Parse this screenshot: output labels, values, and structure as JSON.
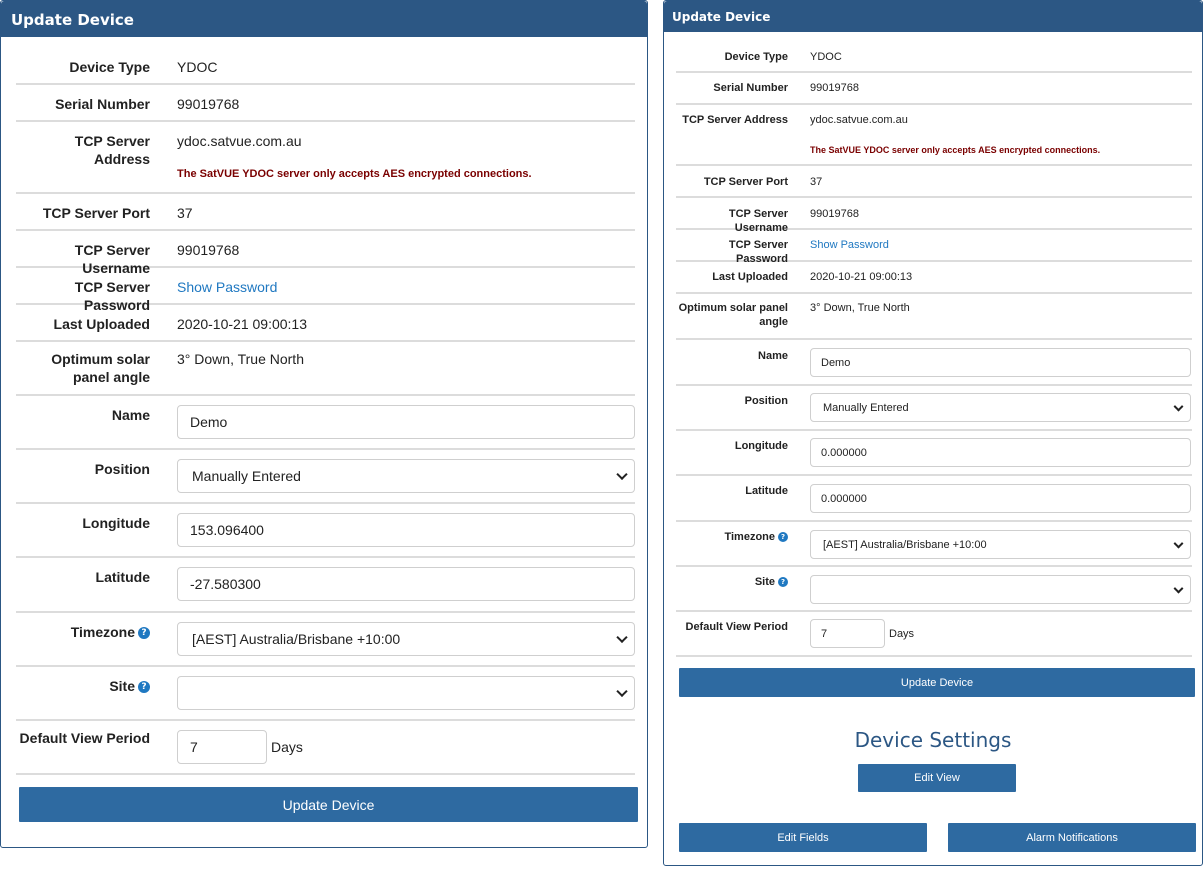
{
  "panel": {
    "title": "Update Device",
    "fields": {
      "device_type": {
        "label": "Device Type",
        "value": "YDOC"
      },
      "serial_number": {
        "label": "Serial Number",
        "value": "99019768"
      },
      "tcp_server_address": {
        "label": "TCP Server Address",
        "value": "ydoc.satvue.com.au",
        "notice": "The SatVUE YDOC server only accepts AES encrypted connections."
      },
      "tcp_server_port": {
        "label": "TCP Server Port",
        "value": "37"
      },
      "tcp_server_username": {
        "label": "TCP Server Username",
        "value": "99019768"
      },
      "tcp_server_password": {
        "label": "TCP Server Password",
        "link": "Show Password"
      },
      "last_uploaded": {
        "label": "Last Uploaded",
        "value": "2020-10-21 09:00:13"
      },
      "solar_angle": {
        "label": "Optimum solar panel angle",
        "value": "3° Down, True North"
      },
      "name": {
        "label": "Name",
        "value": "Demo"
      },
      "position": {
        "label": "Position",
        "value": "Manually Entered"
      },
      "longitude": {
        "label": "Longitude"
      },
      "latitude": {
        "label": "Latitude"
      },
      "timezone": {
        "label": "Timezone",
        "value": "[AEST] Australia/Brisbane +10:00"
      },
      "site": {
        "label": "Site",
        "value": ""
      },
      "default_view_period": {
        "label": "Default View Period",
        "value": "7",
        "unit": "Days"
      }
    },
    "update_button": "Update Device",
    "help_glyph": "?"
  },
  "left": {
    "longitude": "153.096400",
    "latitude": "-27.580300"
  },
  "right": {
    "longitude": "0.000000",
    "latitude": "0.000000",
    "device_settings_title": "Device Settings",
    "edit_view": "Edit View",
    "edit_fields": "Edit Fields",
    "alarm_notifications": "Alarm Notifications"
  },
  "colors": {
    "header": "#2c5784",
    "button": "#2e6aa1",
    "link": "#1f78c1",
    "notice": "#7a0000"
  }
}
